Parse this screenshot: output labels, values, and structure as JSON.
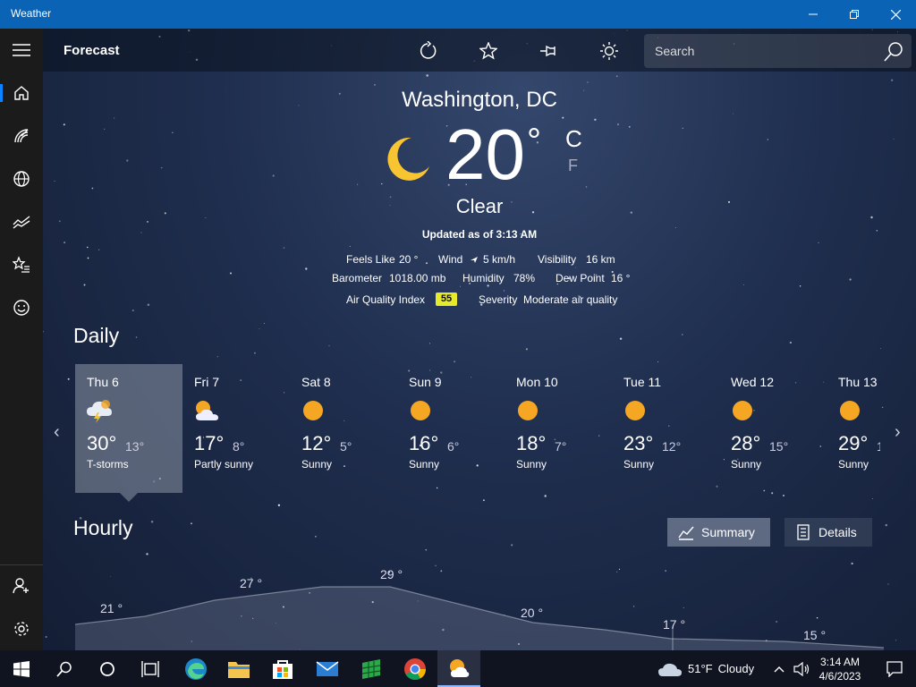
{
  "window": {
    "title": "Weather"
  },
  "header": {
    "title": "Forecast",
    "search_placeholder": "Search"
  },
  "current": {
    "city": "Washington, DC",
    "temp": "20",
    "deg": "°",
    "unit_c": "C",
    "unit_f": "F",
    "condition": "Clear",
    "updated": "Updated as of 3:13 AM",
    "feels_like_label": "Feels Like",
    "feels_like": "20 °",
    "wind_label": "Wind",
    "wind": "5 km/h",
    "visibility_label": "Visibility",
    "visibility": "16 km",
    "barometer_label": "Barometer",
    "barometer": "1018.00 mb",
    "humidity_label": "Humidity",
    "humidity": "78%",
    "dew_point_label": "Dew Point",
    "dew_point": "16 °",
    "aqi_label": "Air Quality Index",
    "aqi": "55",
    "severity_label": "Severity",
    "severity": "Moderate air quality",
    "aqi_color": "#e7ea2b"
  },
  "daily": {
    "title": "Daily",
    "days": [
      {
        "name": "Thu 6",
        "hi": "30°",
        "lo": "13°",
        "cond": "T-storms",
        "icon": "storm-icon"
      },
      {
        "name": "Fri 7",
        "hi": "17°",
        "lo": "8°",
        "cond": "Partly sunny",
        "icon": "partly-sunny-icon"
      },
      {
        "name": "Sat 8",
        "hi": "12°",
        "lo": "5°",
        "cond": "Sunny",
        "icon": "sun-icon"
      },
      {
        "name": "Sun 9",
        "hi": "16°",
        "lo": "6°",
        "cond": "Sunny",
        "icon": "sun-icon"
      },
      {
        "name": "Mon 10",
        "hi": "18°",
        "lo": "7°",
        "cond": "Sunny",
        "icon": "sun-icon"
      },
      {
        "name": "Tue 11",
        "hi": "23°",
        "lo": "12°",
        "cond": "Sunny",
        "icon": "sun-icon"
      },
      {
        "name": "Wed 12",
        "hi": "28°",
        "lo": "15°",
        "cond": "Sunny",
        "icon": "sun-icon"
      },
      {
        "name": "Thu 13",
        "hi": "29°",
        "lo": "1",
        "cond": "Sunny",
        "icon": "sun-icon"
      }
    ]
  },
  "hourly": {
    "title": "Hourly",
    "summary_label": "Summary",
    "details_label": "Details",
    "points": [
      "21 °",
      "27 °",
      "29 °",
      "20 °",
      "17 °",
      "15 °"
    ]
  },
  "taskbar": {
    "weather_temp": "51°F",
    "weather_cond": "Cloudy",
    "time": "3:14 AM",
    "date": "4/6/2023"
  },
  "colors": {
    "accent": "#0a63b4",
    "sun": "#f5a623",
    "moon": "#f7c531"
  }
}
